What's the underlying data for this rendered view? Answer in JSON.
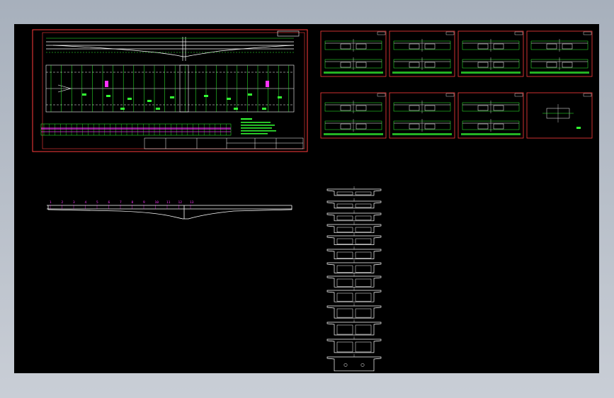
{
  "window": {
    "title": "",
    "background": "#b8bfc9"
  },
  "canvas": {
    "background": "#000000",
    "colors": {
      "frame": "#ff3b3b",
      "line": "#ffffff",
      "annotation": "#33ff33",
      "highlight": "#ff33ff",
      "accent": "#ffff00"
    }
  },
  "main_sheet": {
    "title_block_text": "",
    "sheet_label": ""
  },
  "detail_sheets": {
    "count": 8
  },
  "elevation": {
    "node_marks": [
      "1",
      "2",
      "3",
      "4",
      "5",
      "6",
      "7",
      "8",
      "9",
      "10",
      "11",
      "12",
      "13"
    ]
  },
  "sections": {
    "count": 13
  }
}
